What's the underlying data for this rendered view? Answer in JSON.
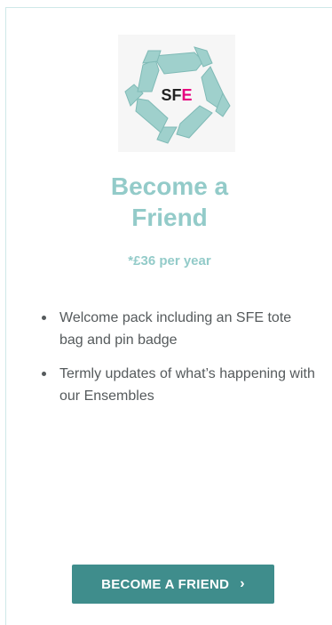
{
  "logo": {
    "text_prefix": "SF",
    "text_suffix": "E",
    "hand_color": "#9fd0cc",
    "accent_color": "#e6007e"
  },
  "card": {
    "title_line1": "Become a",
    "title_line2": "Friend",
    "price": "*£36 per year",
    "benefits": [
      "Welcome pack including an SFE tote bag and pin badge",
      "Termly updates of what’s happening with our Ensembles"
    ],
    "cta_label": "BECOME A FRIEND",
    "cta_icon": "chevron-right-icon"
  },
  "colors": {
    "title": "#93cbc9",
    "button": "#3f8d8c",
    "body_text": "#555a5c"
  }
}
